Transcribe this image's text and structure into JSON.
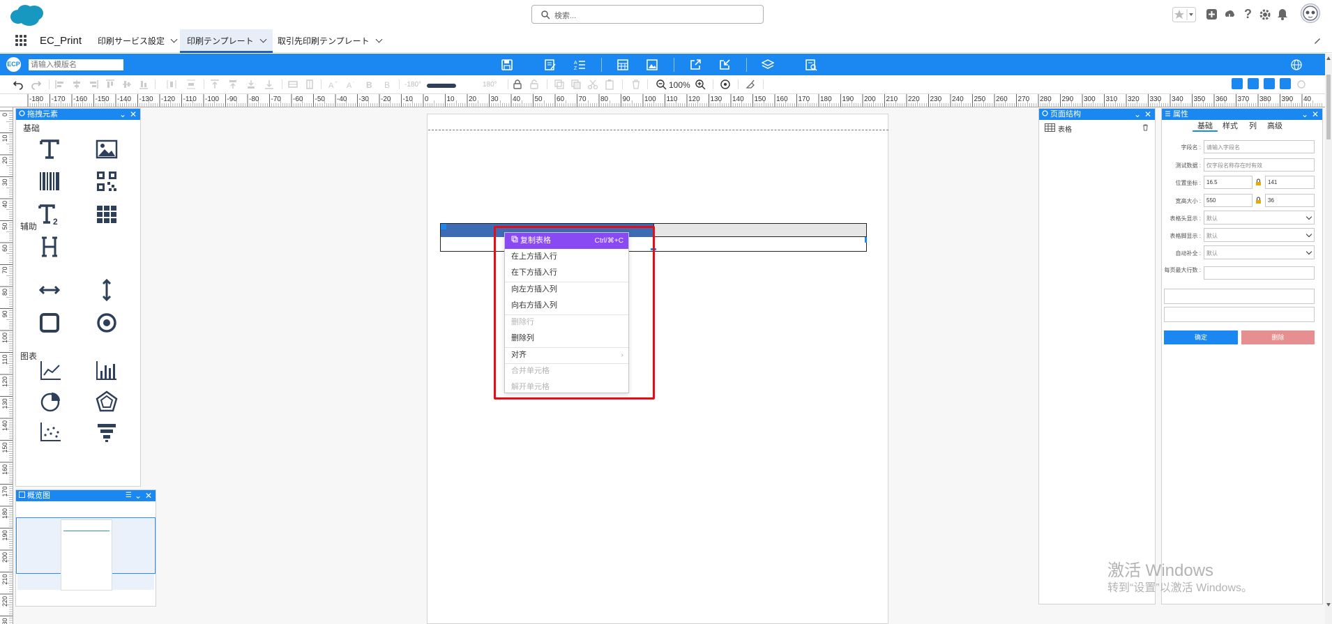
{
  "search": {
    "placeholder": "検索..."
  },
  "nav": {
    "app_name": "EC_Print",
    "tabs": [
      {
        "label": "印刷サービス設定"
      },
      {
        "label": "印刷テンプレート"
      },
      {
        "label": "取引先印刷テンプレート"
      }
    ]
  },
  "designer": {
    "logo": "ECP",
    "template_name_placeholder": "请输入模版名",
    "zoom": "100%",
    "angle_min": "-180°",
    "angle_max": "180°"
  },
  "hruler": [
    "-180",
    "-170",
    "-160",
    "-150",
    "-140",
    "-130",
    "-120",
    "-110",
    "-100",
    "-90",
    "-80",
    "-70",
    "-60",
    "-50",
    "-40",
    "-30",
    "-20",
    "-10",
    "0",
    "10",
    "20",
    "30",
    "40",
    "50",
    "60",
    "70",
    "80",
    "90",
    "100",
    "110",
    "120",
    "130",
    "140",
    "150",
    "160",
    "170",
    "180",
    "190",
    "200",
    "210",
    "220",
    "230",
    "240",
    "250",
    "260",
    "270",
    "280",
    "290",
    "300",
    "310",
    "320",
    "330",
    "340",
    "350",
    "360",
    "370",
    "380",
    "390",
    "40"
  ],
  "vruler": [
    "0",
    "10",
    "20",
    "30",
    "40",
    "50",
    "60",
    "70",
    "80",
    "90",
    "100",
    "110",
    "120",
    "130",
    "140",
    "150",
    "160",
    "170",
    "180",
    "190",
    "200",
    "210",
    "220",
    "230"
  ],
  "elements_panel": {
    "title": "拖拽元素",
    "section_basic": "基础",
    "section_aux": "辅助",
    "section_chart": "图表"
  },
  "overview_panel": {
    "title": "概览图"
  },
  "structure_panel": {
    "title": "页面结构",
    "item": "表格"
  },
  "context_menu": {
    "items": [
      {
        "label": "复制表格",
        "shortcut": "Ctrl/⌘+C"
      },
      {
        "label": "在上方插入行"
      },
      {
        "label": "在下方插入行"
      },
      {
        "label": "向左方插入列"
      },
      {
        "label": "向右方插入列"
      },
      {
        "label": "删除行"
      },
      {
        "label": "删除列"
      },
      {
        "label": "对齐",
        "arrow": "›"
      },
      {
        "label": "合并单元格"
      },
      {
        "label": "解开单元格"
      }
    ]
  },
  "properties": {
    "title": "属性",
    "tabs": [
      "基础",
      "样式",
      "列",
      "高级"
    ],
    "field_name_label": "字段名 :",
    "field_name_placeholder": "请输入字段名",
    "test_data_label": "测试数据 :",
    "test_data_placeholder": "仅字段名称存在时有效",
    "position_label": "位置坐标 :",
    "pos_x": "16.5",
    "pos_y": "141",
    "size_label": "宽高大小 :",
    "width": "550",
    "height": "36",
    "header_display_label": "表格头显示 :",
    "header_display_value": "默认",
    "footer_display_label": "表格脚显示 :",
    "footer_display_value": "默认",
    "autofill_label": "自动补全 :",
    "autofill_value": "默认",
    "max_rows_label": "每页最大行数 :",
    "confirm": "确定",
    "delete": "删除"
  },
  "watermark": {
    "line1": "激活 Windows",
    "line2": "转到“设置”以激活 Windows。"
  }
}
